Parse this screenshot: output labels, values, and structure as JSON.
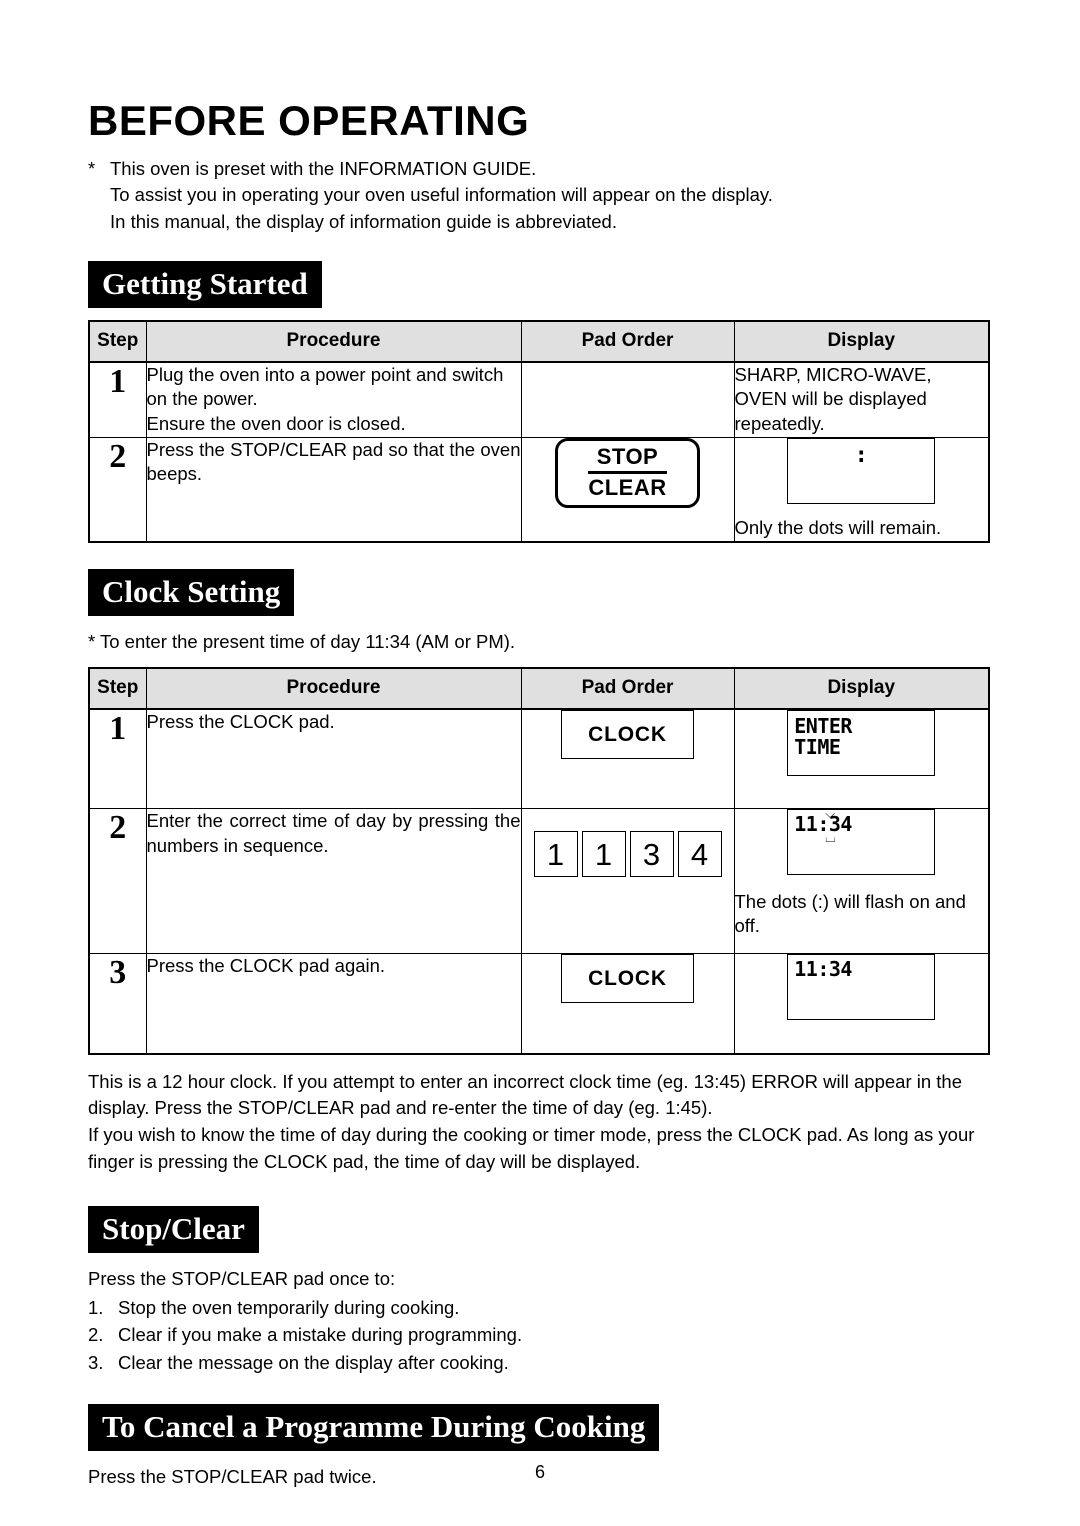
{
  "document": {
    "title": "BEFORE OPERATING",
    "page_number": "6"
  },
  "intro": {
    "star": "*",
    "line1": "This oven is preset with the INFORMATION GUIDE.",
    "line2": "To assist you in operating your oven useful information will appear on the display.",
    "line3": "In this manual, the display of information guide is abbreviated."
  },
  "sections": {
    "getting_started": {
      "banner": "Getting Started",
      "table": {
        "headers": [
          "Step",
          "Procedure",
          "Pad Order",
          "Display"
        ],
        "rows": [
          {
            "step": "1",
            "procedure_lines": [
              "Plug the oven into a power point and switch",
              "on the power.",
              "Ensure the oven door is closed."
            ],
            "pad": {
              "type": "none"
            },
            "display_lines": [
              "SHARP, MICRO-WAVE,",
              "OVEN will be displayed",
              "repeatedly."
            ],
            "display_lcd": null,
            "display_caption": ""
          },
          {
            "step": "2",
            "procedure_lines": [
              "Press the STOP/CLEAR pad so that the oven beeps."
            ],
            "pad": {
              "type": "stopclear",
              "top_label": "STOP",
              "bottom_label": "CLEAR"
            },
            "display_lines": [],
            "display_lcd": {
              "mode": "dots-only",
              "dots": ":"
            },
            "display_caption": "Only the dots will remain."
          }
        ]
      }
    },
    "clock_setting": {
      "banner": "Clock Setting",
      "note": "* To enter the present time of day 11:34 (AM or PM).",
      "table": {
        "headers": [
          "Step",
          "Procedure",
          "Pad Order",
          "Display"
        ],
        "rows": [
          {
            "step": "1",
            "procedure_lines": [
              "Press the CLOCK pad."
            ],
            "pad": {
              "type": "rect",
              "label": "CLOCK"
            },
            "display_lcd": {
              "mode": "text2",
              "line1": "ENTER",
              "line2": "TIME"
            },
            "display_caption": ""
          },
          {
            "step": "2",
            "procedure_lines": [
              "Enter the correct time of day by pressing the numbers in sequence."
            ],
            "pad": {
              "type": "numbers",
              "keys": [
                "1",
                "1",
                "3",
                "4"
              ]
            },
            "display_lcd": {
              "mode": "time-flash",
              "text": "11:34",
              "flash_up": "\\u2193",
              "flash_down": "\\u2191"
            },
            "display_caption": "The dots (:) will flash on and off."
          },
          {
            "step": "3",
            "procedure_lines": [
              "Press the CLOCK pad again."
            ],
            "pad": {
              "type": "rect",
              "label": "CLOCK"
            },
            "display_lcd": {
              "mode": "time",
              "text": "11:34"
            },
            "display_caption": ""
          }
        ]
      },
      "notes": [
        "This is a 12 hour clock. If you attempt to enter an incorrect clock time (eg. 13:45)  ERROR will appear in the display. Press the STOP/CLEAR pad and re-enter the time of day (eg. 1:45).",
        "If you wish to know the time of day during the cooking or timer mode, press the CLOCK pad. As long as your finger is pressing the CLOCK pad, the time of day will be displayed."
      ]
    },
    "stop_clear": {
      "banner": "Stop/Clear",
      "intro": "Press the STOP/CLEAR pad once to:",
      "items": [
        {
          "num": "1.",
          "text": "Stop the oven temporarily during cooking."
        },
        {
          "num": "2.",
          "text": "Clear if you make a mistake during programming."
        },
        {
          "num": "3.",
          "text": "Clear the message on the display after cooking."
        }
      ]
    },
    "cancel_programme": {
      "banner": "To Cancel a Programme During Cooking",
      "text": "Press the STOP/CLEAR pad twice."
    }
  },
  "colors": {
    "banner_bg": "#000000",
    "banner_text": "#ffffff",
    "table_header_bg": "#e0e0e0",
    "border": "#000000"
  }
}
